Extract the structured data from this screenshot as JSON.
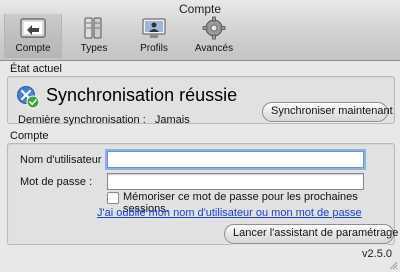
{
  "window": {
    "title": "Compte"
  },
  "toolbar": {
    "items": [
      {
        "label": "Compte",
        "icon": "account-icon"
      },
      {
        "label": "Types",
        "icon": "types-icon"
      },
      {
        "label": "Profils",
        "icon": "profiles-icon"
      },
      {
        "label": "Avancés",
        "icon": "advanced-gear-icon"
      }
    ]
  },
  "status": {
    "section_label": "État actuel",
    "headline": "Synchronisation réussie",
    "last_sync_label": "Dernière synchronisation :",
    "last_sync_value": "Jamais",
    "sync_button": "Synchroniser maintenant"
  },
  "account": {
    "section_label": "Compte",
    "username_label": "Nom d'utilisateur :",
    "username_value": "",
    "password_label": "Mot de passe :",
    "password_value": "",
    "remember_label": "Mémoriser ce mot de passe pour les prochaines sessions.",
    "remember_checked": false,
    "forgot_link": "J'ai oublié mon nom d'utilisateur ou mon mot de passe",
    "wizard_button": "Lancer l'assistant de paramétrage"
  },
  "footer": {
    "version": "v2.5.0"
  }
}
